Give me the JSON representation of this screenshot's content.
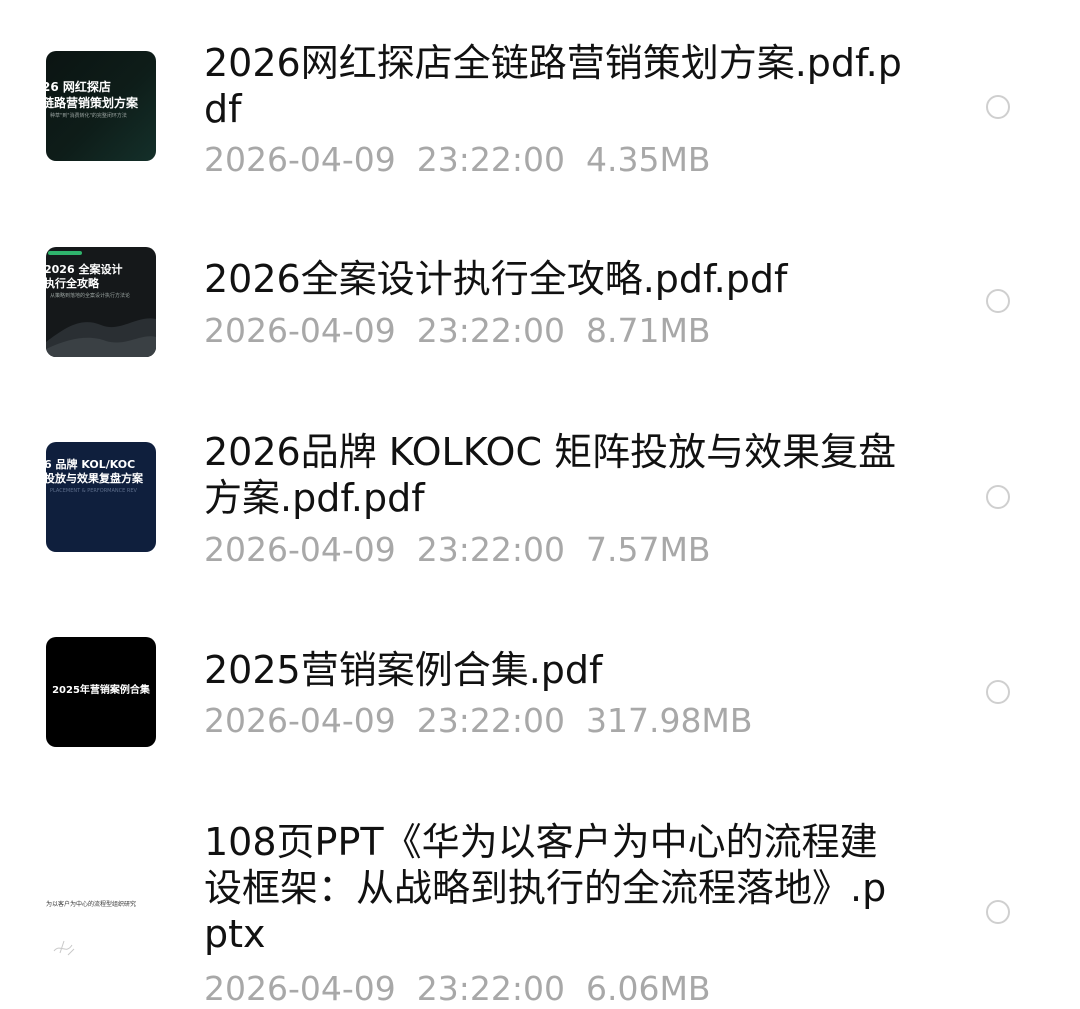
{
  "files": [
    {
      "name": "2026网红探店全链路营销策划方案.pdf.pdf",
      "date": "2026-04-09",
      "time": "23:22:00",
      "size": "4.35MB",
      "thumb": {
        "title": "26 网红探店\n链路营销策划方案",
        "subtitle": "种草\"到\"消费转化\"的完整闭环方法"
      }
    },
    {
      "name": "2026全案设计执行全攻略.pdf.pdf",
      "date": "2026-04-09",
      "time": "23:22:00",
      "size": "8.71MB",
      "thumb": {
        "title": "2026 全案设计\n执行全攻略",
        "subtitle": "从策略到落地的全案设计执行方法论"
      }
    },
    {
      "name": "2026品牌 KOLKOC 矩阵投放与效果复盘方案.pdf.pdf",
      "date": "2026-04-09",
      "time": "23:22:00",
      "size": "7.57MB",
      "thumb": {
        "title": "6 品牌 KOL/KOC\n投放与效果复盘方案",
        "subtitle": "PLACEMENT & PERFORMANCE REV"
      }
    },
    {
      "name": "2025营销案例合集.pdf",
      "date": "2026-04-09",
      "time": "23:22:00",
      "size": "317.98MB",
      "thumb": {
        "title": "2025年营销案例合集"
      }
    },
    {
      "name": "108页PPT《华为以客户为中心的流程建设框架：从战略到执行的全流程落地》.pptx",
      "date": "2026-04-09",
      "time": "23:22:00",
      "size": "6.06MB",
      "thumb": {
        "title": "为以客户为中心的流程型组织研究"
      }
    }
  ],
  "colors": {
    "name_text": "#111111",
    "meta_text": "#a8a8a8",
    "radio_border": "#cfcfcf",
    "thumb1_bg": "#0b1412",
    "thumb2_bg": "#15181a",
    "thumb3_bg": "#0f1f3d",
    "thumb4_bg": "#000000",
    "thumb5_bg": "#ffffff",
    "accent_green": "#2fb36c"
  },
  "icons": {
    "select": "radio-circle-icon"
  }
}
